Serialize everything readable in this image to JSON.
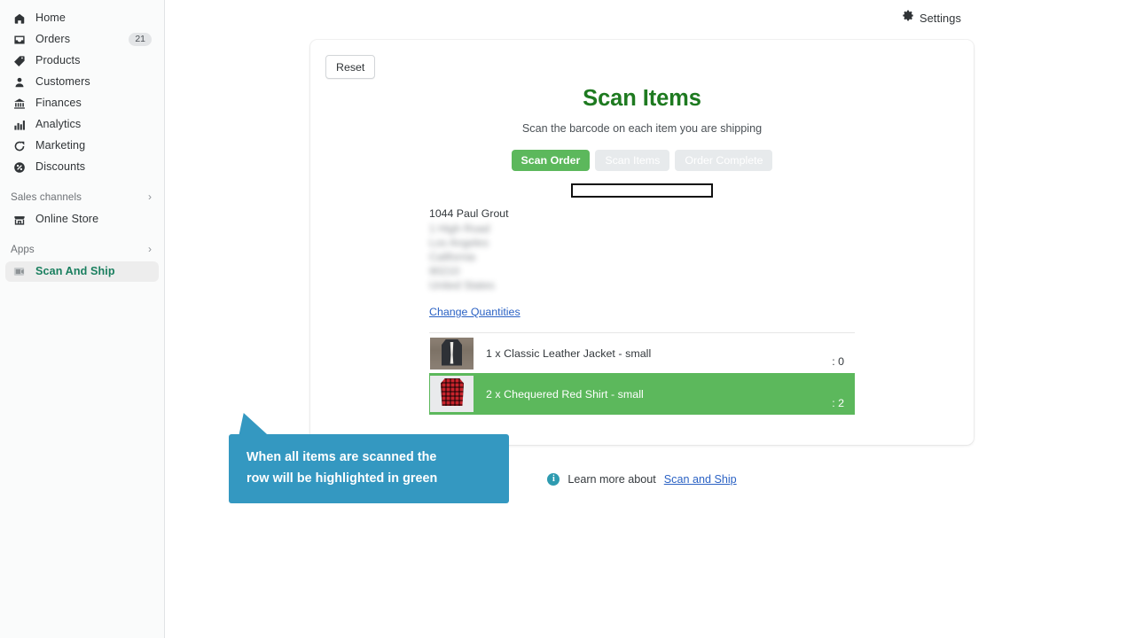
{
  "sidebar": {
    "items": [
      {
        "label": "Home",
        "icon": "home-icon",
        "badge": ""
      },
      {
        "label": "Orders",
        "icon": "orders-icon",
        "badge": "21"
      },
      {
        "label": "Products",
        "icon": "tag-icon",
        "badge": ""
      },
      {
        "label": "Customers",
        "icon": "person-icon",
        "badge": ""
      },
      {
        "label": "Finances",
        "icon": "bank-icon",
        "badge": ""
      },
      {
        "label": "Analytics",
        "icon": "bar-chart-icon",
        "badge": ""
      },
      {
        "label": "Marketing",
        "icon": "megaphone-icon",
        "badge": ""
      },
      {
        "label": "Discounts",
        "icon": "discount-icon",
        "badge": ""
      }
    ],
    "sections": [
      {
        "label": "Sales channels",
        "chevron": "›"
      },
      {
        "label": "Apps",
        "chevron": "›"
      }
    ],
    "online_store": {
      "label": "Online Store",
      "icon": "store-icon"
    },
    "app_item": {
      "label": "Scan And Ship",
      "icon": "scan-ship-icon",
      "active": true
    },
    "active_color": "#1a7f5f"
  },
  "topbar": {
    "settings_label": "Settings",
    "settings_icon": "gear-icon"
  },
  "card": {
    "reset_label": "Reset",
    "title": "Scan Items",
    "title_color": "#1e7a20",
    "subtitle": "Scan the barcode on each item you are shipping",
    "steps": [
      {
        "label": "Scan Order",
        "state": "active"
      },
      {
        "label": "Scan Items",
        "state": "disabled"
      },
      {
        "label": "Order Complete",
        "state": "disabled"
      }
    ],
    "accent_green": "#5cb85c",
    "disabled_grey": "#e7eaec",
    "barcode_input": {
      "value": "",
      "placeholder": ""
    },
    "address": {
      "name": "1044 Paul Grout",
      "lines": [
        "1 High Road",
        "Los Angeles",
        "California",
        "90210",
        "United States"
      ],
      "redacted": true
    },
    "change_quantities_label": "Change Quantities",
    "items": [
      {
        "label": "1 x Classic Leather Jacket - small",
        "count": ": 0",
        "scanned": false,
        "thumb": "jacket-thumbnail"
      },
      {
        "label": "2 x Chequered Red Shirt - small",
        "count": ": 2",
        "scanned": true,
        "thumb": "shirt-thumbnail"
      }
    ]
  },
  "callout": {
    "line1": "When all items are scanned the",
    "line2": "row will be highlighted in green",
    "color": "#3498c1"
  },
  "footer": {
    "info_icon": "info-icon",
    "info_glyph": "i",
    "text": "Learn more about",
    "link": "Scan and Ship"
  }
}
